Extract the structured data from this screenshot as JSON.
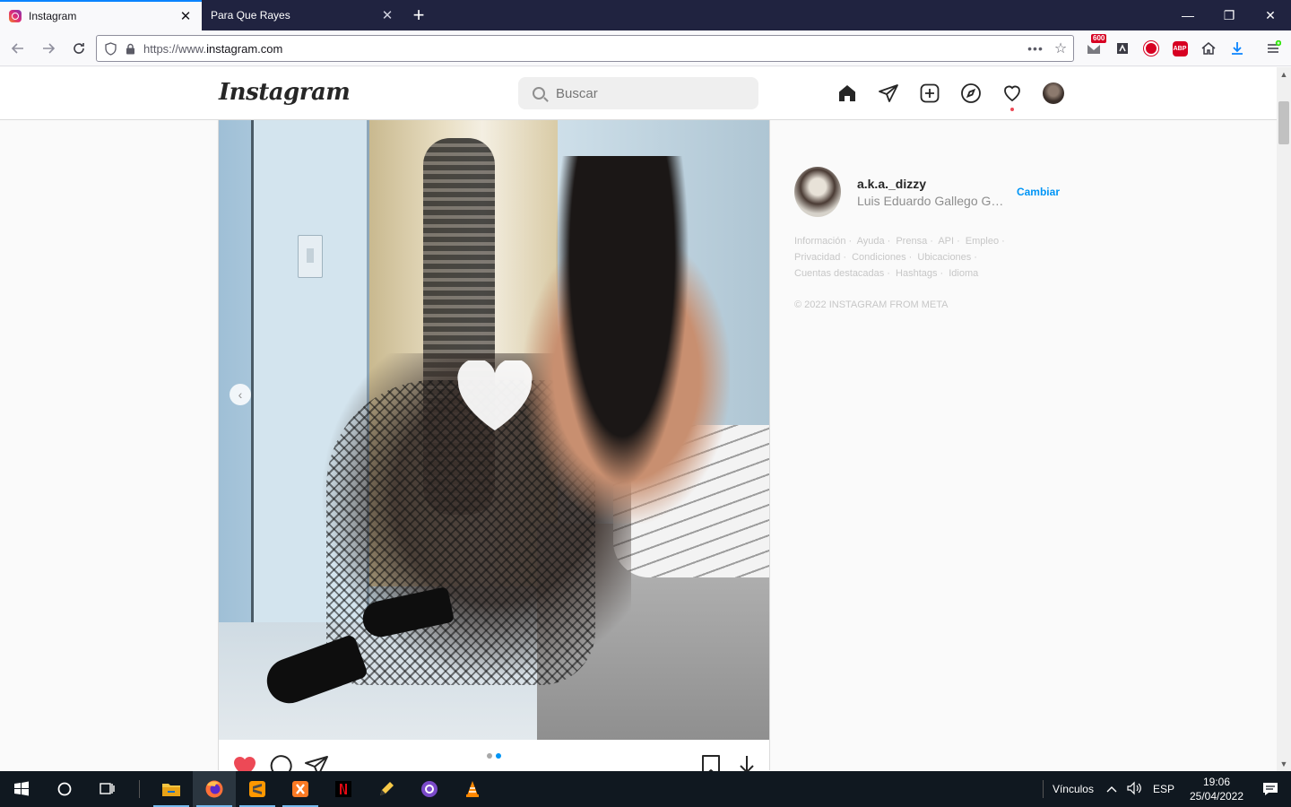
{
  "browser": {
    "tabs": [
      {
        "label": "Instagram",
        "active": true
      },
      {
        "label": "Para Que Rayes",
        "active": false
      }
    ],
    "url_prefix": "https://www.",
    "url_domain": "instagram.com",
    "badge_count": "600",
    "abp_label": "ABP"
  },
  "instagram": {
    "logo": "Instagram",
    "search_placeholder": "Buscar",
    "nav_icons": [
      "home-icon",
      "direct-icon",
      "new-post-icon",
      "explore-icon",
      "activity-icon",
      "profile-avatar"
    ]
  },
  "post": {
    "carousel_count": 2,
    "carousel_active": 2
  },
  "sidebar": {
    "username": "a.k.a._dizzy",
    "full_name": "Luis Eduardo Gallego Gar...",
    "switch_label": "Cambiar",
    "links": [
      "Información",
      "Ayuda",
      "Prensa",
      "API",
      "Empleo",
      "Privacidad",
      "Condiciones",
      "Ubicaciones",
      "Cuentas destacadas",
      "Hashtags",
      "Idioma"
    ],
    "copyright": "© 2022 INSTAGRAM FROM META"
  },
  "taskbar": {
    "links_label": "Vínculos",
    "lang": "ESP",
    "time": "19:06",
    "date": "25/04/2022"
  },
  "colors": {
    "accent": "#0095f6",
    "like": "#ed4956",
    "tabstrip": "#202340"
  }
}
